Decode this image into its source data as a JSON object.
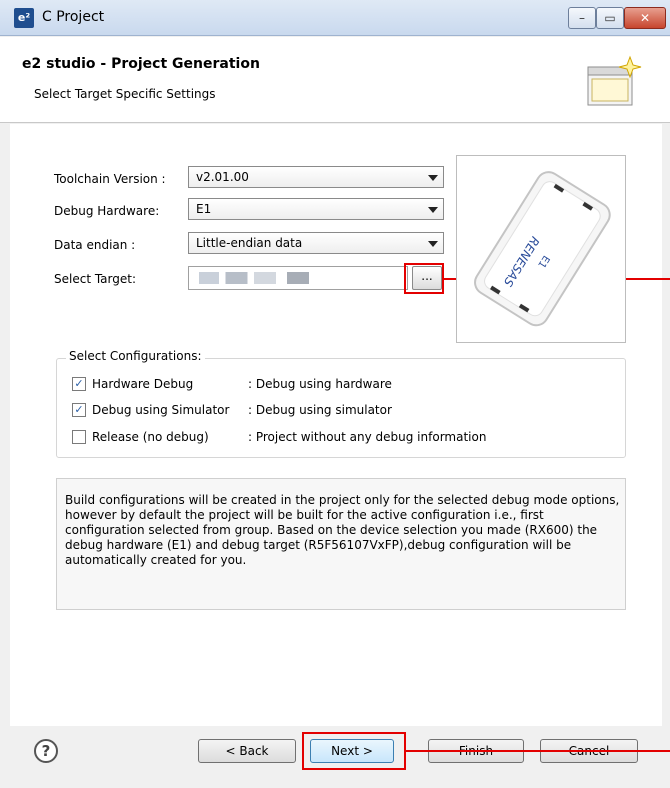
{
  "window": {
    "app_icon": "e²",
    "title": "C Project",
    "min_glyph": "–",
    "max_glyph": "▭",
    "close_glyph": "✕"
  },
  "header": {
    "title": "e2 studio - Project Generation",
    "subtitle": "Select Target Specific Settings",
    "icon": "wizard-banner-icon"
  },
  "form": {
    "toolchain_label": "Toolchain Version :",
    "toolchain_value": "v2.01.00",
    "debug_hw_label": "Debug Hardware:",
    "debug_hw_value": "E1",
    "endian_label": "Data endian :",
    "endian_value": "Little-endian data",
    "target_label": "Select Target:",
    "target_value": "",
    "browse_label": "..."
  },
  "configurations": {
    "title": "Select Configurations:",
    "items": [
      {
        "label": "Hardware Debug",
        "desc": ": Debug using hardware",
        "checked": true
      },
      {
        "label": "Debug using Simulator",
        "desc": ": Debug using simulator",
        "checked": true
      },
      {
        "label": "Release (no debug)",
        "desc": ": Project without any debug information",
        "checked": false
      }
    ]
  },
  "info": "Build configurations will be created in the project only for the selected debug mode options, however by default the project will be built for the active configuration i.e., first configuration selected from group. Based on the device selection you made (RX600) the debug hardware (E1) and debug target (R5F56107VxFP),debug configuration will be automatically created for you.",
  "device_image": {
    "brand": "RENESAS",
    "model": "E1"
  },
  "footer": {
    "help": "?",
    "back": "< Back",
    "next": "Next >",
    "finish": "Finish",
    "cancel": "Cancel"
  },
  "colors": {
    "highlight": "#e30000",
    "title_bar": "#c9d9ee",
    "close_button": "#c7452e"
  }
}
